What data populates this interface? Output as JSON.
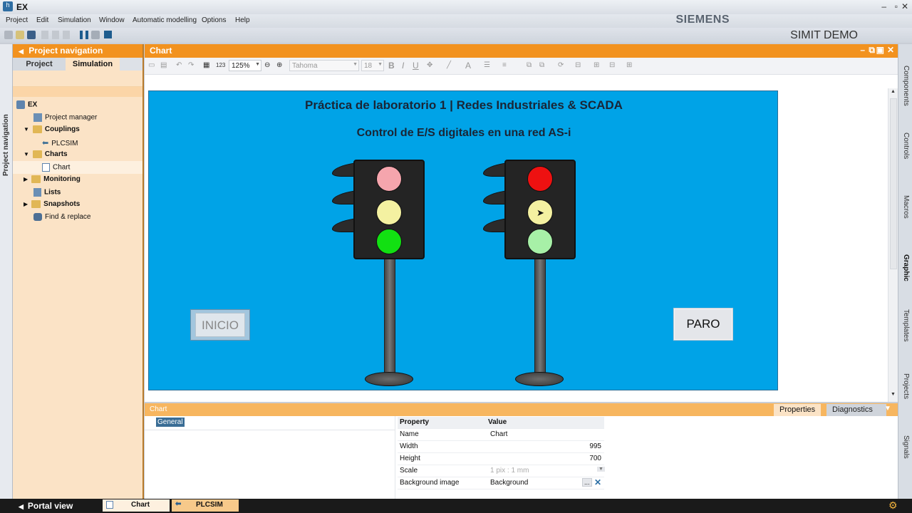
{
  "window": {
    "title": "EX"
  },
  "menu": [
    "Project",
    "Edit",
    "Simulation",
    "Window",
    "Automatic modelling",
    "Options",
    "Help"
  ],
  "brand": {
    "siemens": "SIEMENS",
    "product": "SIMIT DEMO"
  },
  "project_navigation": {
    "vertical_label": "Project navigation",
    "header": "Project navigation",
    "tabs": {
      "project": "Project",
      "simulation": "Simulation"
    },
    "tree": {
      "root": "EX",
      "project_manager": "Project manager",
      "couplings": "Couplings",
      "plcsim": "PLCSIM",
      "charts": "Charts",
      "chart": "Chart",
      "monitoring": "Monitoring",
      "lists": "Lists",
      "snapshots": "Snapshots",
      "find_replace": "Find & replace"
    }
  },
  "chart_window": {
    "title": "Chart",
    "toolbar": {
      "grid_label": "123",
      "zoom": "125%",
      "font": "Tahoma",
      "font_size": "18",
      "bold": "B",
      "italic": "I",
      "underline": "U"
    },
    "canvas": {
      "title": "Práctica de laboratorio 1 | Redes Industriales & SCADA",
      "subtitle": "Control de E/S digitales en una red AS-i",
      "inicio_button": "INICIO",
      "paro_button": "PARO"
    }
  },
  "right_tabs": [
    "Components",
    "Controls",
    "Macros",
    "Graphic",
    "Templates",
    "Projects",
    "Signals"
  ],
  "properties_panel": {
    "title": "Chart",
    "tabs": {
      "properties": "Properties",
      "diagnostics": "Diagnostics"
    },
    "general": "General",
    "header": {
      "property": "Property",
      "value": "Value"
    },
    "rows": [
      {
        "property": "Name",
        "value": "Chart"
      },
      {
        "property": "Width",
        "value": "995"
      },
      {
        "property": "Height",
        "value": "700"
      },
      {
        "property": "Scale",
        "value": "1 pix : 1 mm"
      },
      {
        "property": "Background image",
        "value": "Background"
      }
    ]
  },
  "taskbar": {
    "portal_view": "Portal view",
    "items": [
      "Chart",
      "PLCSIM"
    ]
  },
  "colors": {
    "accent": "#f2921f",
    "canvas": "#00a3e7",
    "panel": "#fbe3c6"
  }
}
